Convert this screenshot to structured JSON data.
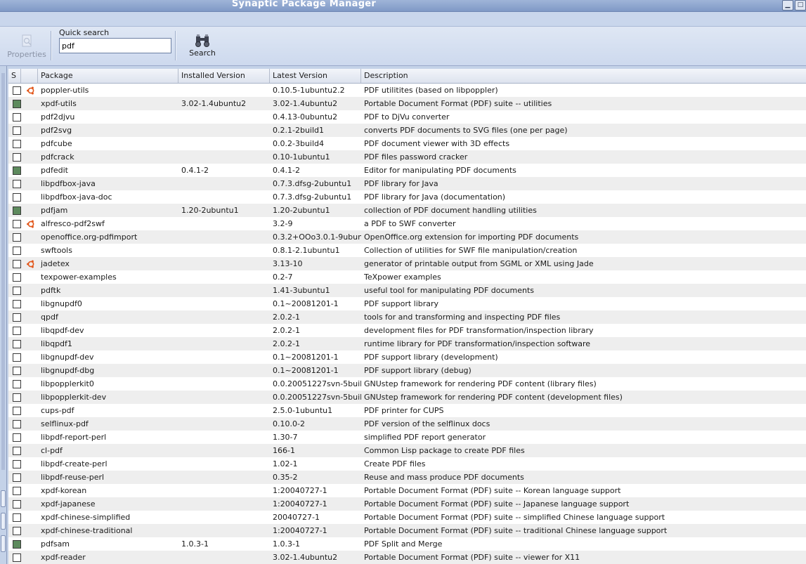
{
  "window": {
    "title": "Synaptic Package Manager"
  },
  "toolbar": {
    "properties_label": "Properties",
    "quick_search_label": "Quick search",
    "quick_search_value": "pdf",
    "search_label": "Search"
  },
  "columns": {
    "status": "S",
    "package": "Package",
    "installed": "Installed Version",
    "latest": "Latest Version",
    "description": "Description"
  },
  "packages": [
    {
      "name": "poppler-utils",
      "installed": "",
      "latest": "0.10.5-1ubuntu2.2",
      "description": "PDF utilitites (based on libpoppler)",
      "status": "not-installed",
      "ubuntu_icon": true
    },
    {
      "name": "xpdf-utils",
      "installed": "3.02-1.4ubuntu2",
      "latest": "3.02-1.4ubuntu2",
      "description": "Portable Document Format (PDF) suite -- utilities",
      "status": "installed",
      "ubuntu_icon": false
    },
    {
      "name": "pdf2djvu",
      "installed": "",
      "latest": "0.4.13-0ubuntu2",
      "description": "PDF to DjVu converter",
      "status": "not-installed",
      "ubuntu_icon": false
    },
    {
      "name": "pdf2svg",
      "installed": "",
      "latest": "0.2.1-2build1",
      "description": "converts PDF documents to SVG files (one per page)",
      "status": "not-installed",
      "ubuntu_icon": false
    },
    {
      "name": "pdfcube",
      "installed": "",
      "latest": "0.0.2-3build4",
      "description": "PDF document viewer with 3D effects",
      "status": "not-installed",
      "ubuntu_icon": false
    },
    {
      "name": "pdfcrack",
      "installed": "",
      "latest": "0.10-1ubuntu1",
      "description": "PDF files password cracker",
      "status": "not-installed",
      "ubuntu_icon": false
    },
    {
      "name": "pdfedit",
      "installed": "0.4.1-2",
      "latest": "0.4.1-2",
      "description": "Editor for manipulating PDF documents",
      "status": "installed",
      "ubuntu_icon": false
    },
    {
      "name": "libpdfbox-java",
      "installed": "",
      "latest": "0.7.3.dfsg-2ubuntu1",
      "description": "PDF library for Java",
      "status": "not-installed",
      "ubuntu_icon": false
    },
    {
      "name": "libpdfbox-java-doc",
      "installed": "",
      "latest": "0.7.3.dfsg-2ubuntu1",
      "description": "PDF library for Java (documentation)",
      "status": "not-installed",
      "ubuntu_icon": false
    },
    {
      "name": "pdfjam",
      "installed": "1.20-2ubuntu1",
      "latest": "1.20-2ubuntu1",
      "description": "collection of PDF document handling utilities",
      "status": "installed",
      "ubuntu_icon": false
    },
    {
      "name": "alfresco-pdf2swf",
      "installed": "",
      "latest": "3.2-9",
      "description": "a PDF to SWF converter",
      "status": "not-installed",
      "ubuntu_icon": true
    },
    {
      "name": "openoffice.org-pdfimport",
      "installed": "",
      "latest": "0.3.2+OOo3.0.1-9ubun",
      "description": "OpenOffice.org extension for importing PDF documents",
      "status": "not-installed",
      "ubuntu_icon": false
    },
    {
      "name": "swftools",
      "installed": "",
      "latest": "0.8.1-2.1ubuntu1",
      "description": "Collection of utilities for SWF file manipulation/creation",
      "status": "not-installed",
      "ubuntu_icon": false
    },
    {
      "name": "jadetex",
      "installed": "",
      "latest": "3.13-10",
      "description": "generator of printable output from SGML or XML using Jade",
      "status": "not-installed",
      "ubuntu_icon": true
    },
    {
      "name": "texpower-examples",
      "installed": "",
      "latest": "0.2-7",
      "description": "TeXpower examples",
      "status": "not-installed",
      "ubuntu_icon": false
    },
    {
      "name": "pdftk",
      "installed": "",
      "latest": "1.41-3ubuntu1",
      "description": "useful tool for manipulating PDF documents",
      "status": "not-installed",
      "ubuntu_icon": false
    },
    {
      "name": "libgnupdf0",
      "installed": "",
      "latest": "0.1~20081201-1",
      "description": "PDF support library",
      "status": "not-installed",
      "ubuntu_icon": false
    },
    {
      "name": "qpdf",
      "installed": "",
      "latest": "2.0.2-1",
      "description": "tools for and transforming and inspecting PDF files",
      "status": "not-installed",
      "ubuntu_icon": false
    },
    {
      "name": "libqpdf-dev",
      "installed": "",
      "latest": "2.0.2-1",
      "description": "development files for PDF transformation/inspection library",
      "status": "not-installed",
      "ubuntu_icon": false
    },
    {
      "name": "libqpdf1",
      "installed": "",
      "latest": "2.0.2-1",
      "description": "runtime library for PDF transformation/inspection software",
      "status": "not-installed",
      "ubuntu_icon": false
    },
    {
      "name": "libgnupdf-dev",
      "installed": "",
      "latest": "0.1~20081201-1",
      "description": "PDF support library (development)",
      "status": "not-installed",
      "ubuntu_icon": false
    },
    {
      "name": "libgnupdf-dbg",
      "installed": "",
      "latest": "0.1~20081201-1",
      "description": "PDF support library (debug)",
      "status": "not-installed",
      "ubuntu_icon": false
    },
    {
      "name": "libpopplerkit0",
      "installed": "",
      "latest": "0.0.20051227svn-5buil",
      "description": "GNUstep framework for rendering PDF content (library files)",
      "status": "not-installed",
      "ubuntu_icon": false
    },
    {
      "name": "libpopplerkit-dev",
      "installed": "",
      "latest": "0.0.20051227svn-5buil",
      "description": "GNUstep framework for rendering PDF content (development files)",
      "status": "not-installed",
      "ubuntu_icon": false
    },
    {
      "name": "cups-pdf",
      "installed": "",
      "latest": "2.5.0-1ubuntu1",
      "description": "PDF printer for CUPS",
      "status": "not-installed",
      "ubuntu_icon": false
    },
    {
      "name": "selflinux-pdf",
      "installed": "",
      "latest": "0.10.0-2",
      "description": "PDF version of the selflinux docs",
      "status": "not-installed",
      "ubuntu_icon": false
    },
    {
      "name": "libpdf-report-perl",
      "installed": "",
      "latest": "1.30-7",
      "description": "simplified PDF report generator",
      "status": "not-installed",
      "ubuntu_icon": false
    },
    {
      "name": "cl-pdf",
      "installed": "",
      "latest": "166-1",
      "description": "Common Lisp package to create PDF files",
      "status": "not-installed",
      "ubuntu_icon": false
    },
    {
      "name": "libpdf-create-perl",
      "installed": "",
      "latest": "1.02-1",
      "description": "Create PDF files",
      "status": "not-installed",
      "ubuntu_icon": false
    },
    {
      "name": "libpdf-reuse-perl",
      "installed": "",
      "latest": "0.35-2",
      "description": "Reuse and mass produce PDF documents",
      "status": "not-installed",
      "ubuntu_icon": false
    },
    {
      "name": "xpdf-korean",
      "installed": "",
      "latest": "1:20040727-1",
      "description": "Portable Document Format (PDF) suite -- Korean language support",
      "status": "not-installed",
      "ubuntu_icon": false
    },
    {
      "name": "xpdf-japanese",
      "installed": "",
      "latest": "1:20040727-1",
      "description": "Portable Document Format (PDF) suite -- Japanese language support",
      "status": "not-installed",
      "ubuntu_icon": false
    },
    {
      "name": "xpdf-chinese-simplified",
      "installed": "",
      "latest": "20040727-1",
      "description": "Portable Document Format (PDF) suite -- simplified Chinese language support",
      "status": "not-installed",
      "ubuntu_icon": false
    },
    {
      "name": "xpdf-chinese-traditional",
      "installed": "",
      "latest": "1:20040727-1",
      "description": "Portable Document Format (PDF) suite -- traditional Chinese language support",
      "status": "not-installed",
      "ubuntu_icon": false
    },
    {
      "name": "pdfsam",
      "installed": "1.0.3-1",
      "latest": "1.0.3-1",
      "description": "PDF Split and Merge",
      "status": "installed",
      "ubuntu_icon": false
    },
    {
      "name": "xpdf-reader",
      "installed": "",
      "latest": "3.02-1.4ubuntu2",
      "description": "Portable Document Format (PDF) suite -- viewer for X11",
      "status": "not-installed",
      "ubuntu_icon": false
    }
  ],
  "colors": {
    "installed_status": "#5d8a5d",
    "ubuntu_icon": "#e2571b",
    "row_alt": "#eeeeee"
  }
}
